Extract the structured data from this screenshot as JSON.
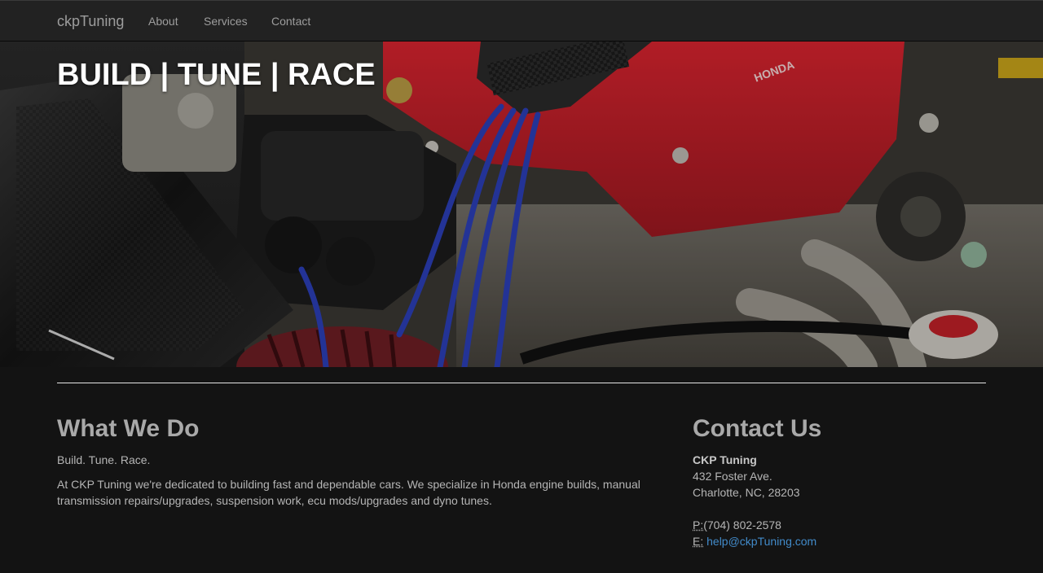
{
  "nav": {
    "brand": "ckpTuning",
    "links": [
      "About",
      "Services",
      "Contact"
    ]
  },
  "hero": {
    "title": "BUILD | TUNE | RACE",
    "engine_badge": "HONDA"
  },
  "what_we_do": {
    "heading": "What We Do",
    "tagline": "Build. Tune. Race.",
    "body": "At CKP Tuning we're dedicated to building fast and dependable cars. We specialize in Honda engine builds, manual transmission repairs/upgrades, suspension work, ecu mods/upgrades and dyno tunes."
  },
  "contact": {
    "heading": "Contact Us",
    "name": "CKP Tuning",
    "street": "432 Foster Ave.",
    "city": "Charlotte, NC, 28203",
    "phone_label": "P:",
    "phone": "(704) 802-2578",
    "email_label": "E:",
    "email": "help@ckpTuning.com"
  },
  "colors": {
    "link": "#428bca",
    "valve_cover": "#c8202c",
    "background": "#131313"
  }
}
